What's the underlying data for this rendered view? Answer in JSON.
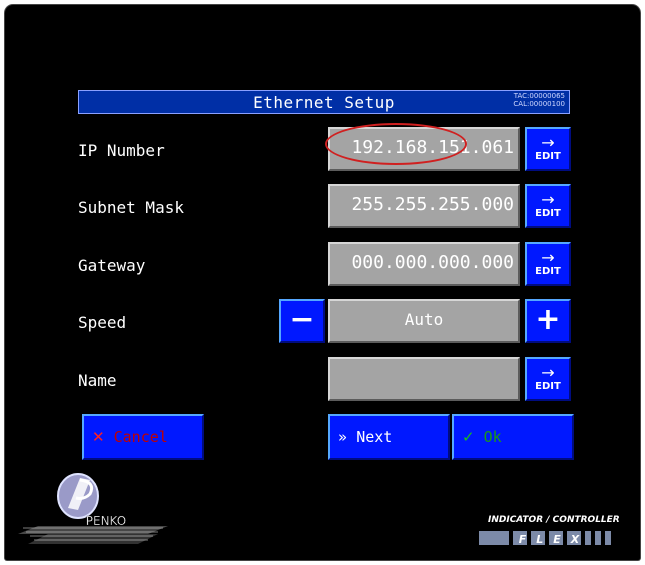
{
  "header": {
    "title": "Ethernet Setup",
    "tac": "TAC:00000065",
    "cal": "CAL:00000100"
  },
  "rows": {
    "ip": {
      "label": "IP Number",
      "value": "192.168.151.061",
      "edit_label": "EDIT"
    },
    "subnet": {
      "label": "Subnet Mask",
      "value": "255.255.255.000",
      "edit_label": "EDIT"
    },
    "gateway": {
      "label": "Gateway",
      "value": "000.000.000.000",
      "edit_label": "EDIT"
    },
    "speed": {
      "label": "Speed",
      "value": "Auto",
      "minus": "−",
      "plus": "+"
    },
    "name": {
      "label": "Name",
      "value": "",
      "edit_label": "EDIT"
    }
  },
  "actions": {
    "cancel": "Cancel",
    "next": "Next",
    "ok": "Ok"
  },
  "branding": {
    "company": "PENKO",
    "tagline": "INDICATOR / CONTROLLER",
    "product": "FLEX"
  },
  "colors": {
    "accent_blue": "#0018ff",
    "cancel_text": "#c00000",
    "ok_text": "#1a9a1a",
    "highlight": "#d02020"
  }
}
